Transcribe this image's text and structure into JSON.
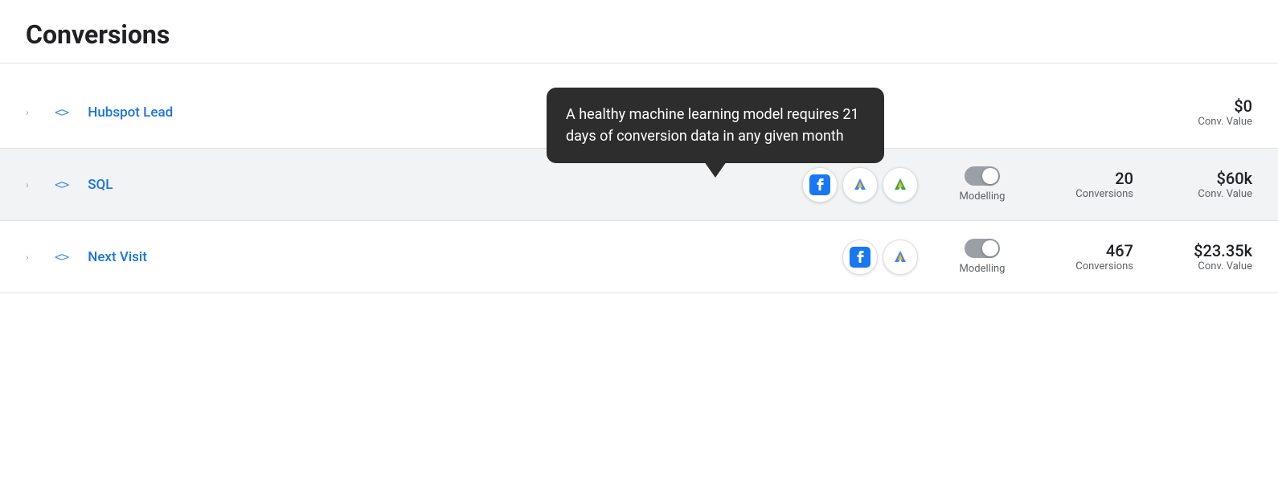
{
  "page": {
    "title": "Conversions"
  },
  "tooltip": {
    "text": "A healthy machine learning model requires 21 days of conversion data in any given month"
  },
  "rows": [
    {
      "id": "hubspot-lead",
      "name": "Hubspot Lead",
      "highlighted": false,
      "platforms": [],
      "modelling": null,
      "conversions": null,
      "conv_value": "$0",
      "conv_value_label": "Conv. Value"
    },
    {
      "id": "sql",
      "name": "SQL",
      "highlighted": true,
      "platforms": [
        "facebook",
        "google-ads-blue",
        "google-ads-green"
      ],
      "modelling": "off",
      "modelling_label": "Modelling",
      "conversions": "20",
      "conversions_label": "Conversions",
      "conv_value": "$60k",
      "conv_value_label": "Conv. Value"
    },
    {
      "id": "next-visit",
      "name": "Next Visit",
      "highlighted": false,
      "platforms": [
        "facebook",
        "google-ads-blue"
      ],
      "modelling": "off",
      "modelling_label": "Modelling",
      "conversions": "467",
      "conversions_label": "Conversions",
      "conv_value": "$23.35k",
      "conv_value_label": "Conv. Value"
    }
  ],
  "icons": {
    "expand": "›",
    "code": "<>"
  }
}
